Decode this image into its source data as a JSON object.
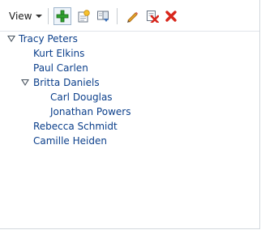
{
  "toolbar": {
    "view_label": "View",
    "icons": [
      "add-icon",
      "new-item-icon",
      "properties-icon",
      "edit-icon",
      "delete-icon",
      "remove-icon"
    ]
  },
  "tree": [
    {
      "label": "Tracy Peters",
      "expanded": true,
      "level": 0
    },
    {
      "label": "Kurt Elkins",
      "level": 1
    },
    {
      "label": "Paul Carlen",
      "level": 1
    },
    {
      "label": "Britta Daniels",
      "expanded": true,
      "level": 1
    },
    {
      "label": "Carl Douglas",
      "level": 2
    },
    {
      "label": "Jonathan Powers",
      "level": 2
    },
    {
      "label": "Rebecca Schmidt",
      "level": 1
    },
    {
      "label": "Camille Heiden",
      "level": 1
    }
  ],
  "colors": {
    "link": "#0b3f8b",
    "add": "#2fa02f",
    "delete": "#d8261b",
    "edit": "#e2a12a"
  }
}
